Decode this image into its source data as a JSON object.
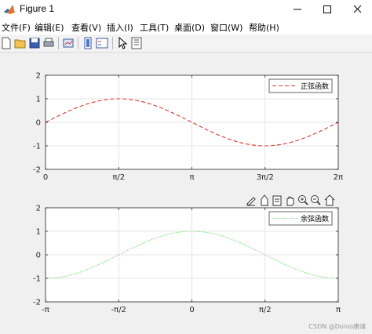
{
  "window": {
    "title": "Figure 1"
  },
  "menu": {
    "items": [
      "文件(F)",
      "编辑(E)",
      "查看(V)",
      "插入(I)",
      "工具(T)",
      "桌面(D)",
      "窗口(W)",
      "帮助(H)"
    ]
  },
  "toolbar": {
    "icons": [
      "new-figure-icon",
      "open-folder-icon",
      "save-icon",
      "print-icon",
      "link-plot-icon",
      "insert-colorbar-icon",
      "insert-legend-icon",
      "pointer-icon",
      "property-inspector-icon"
    ]
  },
  "axes_toolbar": {
    "icons": [
      "brush-icon",
      "data-cursor-icon",
      "save-figure-icon",
      "pan-icon",
      "zoom-in-icon",
      "zoom-out-icon",
      "home-icon"
    ]
  },
  "chart_data": [
    {
      "type": "line",
      "series": [
        {
          "name": "正弦函数",
          "function": "sin(x)",
          "color": "#e8322b",
          "line_style": "dashed"
        }
      ],
      "xlim": [
        0,
        6.2832
      ],
      "ylim": [
        -2,
        2
      ],
      "xticks": [
        0,
        1.5708,
        3.1416,
        4.7124,
        6.2832
      ],
      "xtick_labels": [
        "0",
        "π/2",
        "π",
        "3π/2",
        "2π"
      ],
      "yticks": [
        -2,
        -1,
        0,
        1,
        2
      ],
      "ytick_labels": [
        "-2",
        "-1",
        "0",
        "1",
        "2"
      ],
      "grid": true,
      "legend_position": "top-right"
    },
    {
      "type": "line",
      "series": [
        {
          "name": "余弦函数",
          "function": "cos(x)",
          "color": "#7ee07e",
          "line_style": "dotted"
        }
      ],
      "xlim": [
        -3.1416,
        3.1416
      ],
      "ylim": [
        -2,
        2
      ],
      "xticks": [
        -3.1416,
        -1.5708,
        0,
        1.5708,
        3.1416
      ],
      "xtick_labels": [
        "-π",
        "-π/2",
        "0",
        "π/2",
        "π"
      ],
      "yticks": [
        -2,
        -1,
        0,
        1,
        2
      ],
      "ytick_labels": [
        "-2",
        "-1",
        "0",
        "1",
        "2"
      ],
      "grid": true,
      "legend_position": "top-right"
    }
  ],
  "watermark": "CSDN @Donio唐靖"
}
